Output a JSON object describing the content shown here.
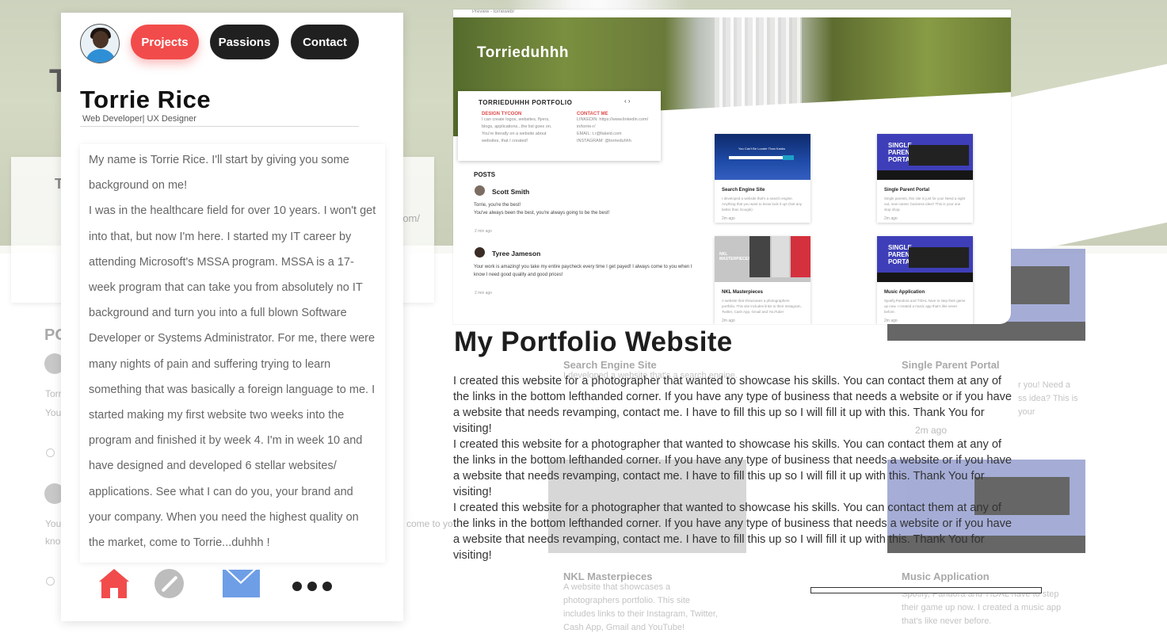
{
  "background": {
    "hero_initial": "T",
    "card_initial": "T",
    "card_suffix": "om/",
    "posts_label": "PO",
    "post1_text": "Torr",
    "post1_text2": "You",
    "post2_text": "You",
    "post2_text2": "kno",
    "post2_overflow": "come to yo",
    "tiles": [
      {
        "label": "Search Engine Site",
        "desc": "I developed a website that's a search engine."
      },
      {
        "label": "Single Parent Portal",
        "desc": "r you! Need a\nss idea? This is your"
      },
      {
        "label": "NKL Masterpieces",
        "desc": "A website that showcases a photographers portfolio. This site includes links to their Instagram, Twitter, Cash App, Gmail and YouTube!"
      },
      {
        "label": "Music Application",
        "desc": "Spotify, Pandora and TIDAL have to step their game up now. I created a music app that's like never before."
      }
    ],
    "time_label": "2m ago"
  },
  "profile": {
    "name": "Torrie Rice",
    "role": "Web Developer| UX Designer",
    "bio_paragraphs": [
      "My name is Torrie Rice. I'll start by giving you some background on me!",
      "I was in the healthcare field for over 10 years. I won't get into that, but now I'm here. I started my IT career by attending Microsoft's MSSA program. MSSA is a 17-week program that can take you from absolutely no IT background and turn you into a full blown Software Developer or Systems Administrator. For me, there were many nights of pain and suffering trying to learn something that was basically a foreign language to me. I started making my first website two weeks into the program and finished it by week 4. I'm in week 10 and have designed and developed 6 stellar websites/ applications. See what I can do you, your brand and your company. When you need the highest quality on the market, come to Torrie...duhhh !"
    ]
  },
  "nav": {
    "projects": "Projects",
    "passions": "Passions",
    "contact": "Contact"
  },
  "bottom_nav": {
    "home_icon": "home-icon",
    "compass_icon": "compass-icon",
    "mail_icon": "mail-icon",
    "more_icon": "more-icon"
  },
  "preview": {
    "window_title": "Preview - torriewebr",
    "site_title": "Torrieduhhh",
    "card_heading": "TORRIEDUHHH  PORTFOLIO",
    "card_arrows": "‹   ›",
    "col1_heading": "DESIGN TYCOON",
    "col1_lines": [
      "I can create logos, websites, flyers,",
      "blogs, applications...the list goes on.",
      "You're literally on a website about",
      "websites, that I created!"
    ],
    "col2_heading": "CONTACT ME",
    "col2_lines": [
      "LINKEDIN: https://www.linkedin.com/",
      "in/torrie-r/",
      "EMAIL: t.r@fakeid.com",
      "INSTAGRAM: @torrieduhhh"
    ],
    "posts_label": "POSTS",
    "posts": [
      {
        "name": "Scott Smith",
        "text1": "Torrie, you're the best!",
        "text2": "You've always been the best, you're always going to be the best!",
        "time": "2 min ago"
      },
      {
        "name": "Tyree Jameson",
        "text1": "Your work is amazing! you take my entire paycheck every time I get payed! I always come to you when I",
        "text2": "know I need good quality and good prices!",
        "time": "2 min ago"
      }
    ],
    "tiles": [
      {
        "label": "Search Engine Site",
        "desc": "I developed a website that's a search engine. Anything that you want to know look it up! (Not any better than Google)",
        "time": "2m ago",
        "logo": "You Can't Be Louder Than Kanks"
      },
      {
        "label": "Single Parent Portal",
        "desc": "Single parents, this site is just for you! Need a night out, new career, business idea? This is your one stop shop.",
        "time": "2m ago",
        "logo": "SINGLE\nPARENT\nPORTAL"
      },
      {
        "label": "NKL Masterpieces",
        "desc": "A website that showcases a photographers portfolio. This site includes links to their Instagram, Twitter, Cash App, Gmail and YouTube!",
        "time": "2m ago",
        "logo": "NKL\nMASTERPIECES"
      },
      {
        "label": "Music Application",
        "desc": "Spotify,Pandora and TIDAL have to step their game up now. I created a music app that's like never before.",
        "time": "2m ago",
        "logo": "SINGLE\nPARENT\nPORTAL"
      }
    ]
  },
  "portfolio": {
    "title": "My Portfolio Website",
    "paragraphs": [
      "I created this website for a photographer that wanted to showcase his skills. You can contact them at any of the links in the bottom lefthanded corner. If you have any type of business that needs a website or if you have a website that needs revamping, contact me.  I have to fill this up so I will fill it up with this. Thank You for visiting!",
      "I created this website for a photographer that wanted to showcase his skills. You can contact them at any of the links in the bottom lefthanded corner. If you have any type of business that needs a website or if you have a website that needs revamping, contact me.  I have to fill this up so I will fill it up with this. Thank You for visiting!",
      "I created this website for a photographer that wanted to showcase his skills. You can contact them at any of the links in the bottom lefthanded corner. If you have any type of business that needs a website or if you have a website that needs revamping, contact me.  I have to fill this up so I will fill it up with this. Thank You for visiting!"
    ]
  },
  "colors": {
    "accent_red": "#f24b4b",
    "button_dark": "#202020",
    "mail_blue": "#6e9ee6",
    "tile_blue": "#3e3fb8"
  }
}
